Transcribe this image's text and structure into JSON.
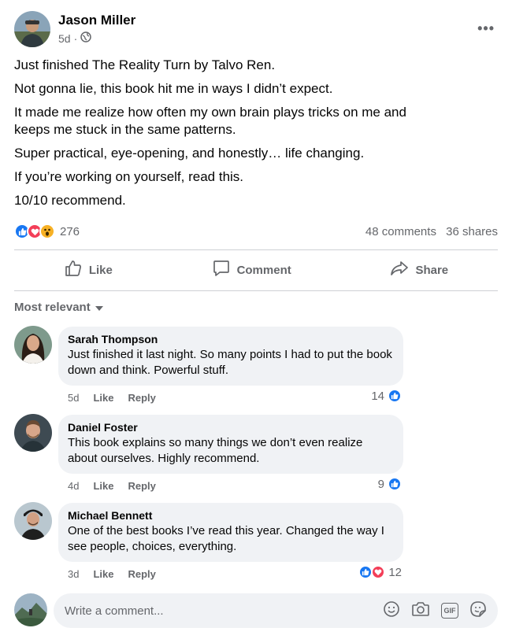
{
  "post": {
    "author": "Jason Miller",
    "time": "5d",
    "separator": "·",
    "body": [
      "Just finished The Reality Turn by Talvo Ren.",
      "Not gonna lie, this book hit me in ways I didn’t expect.",
      "It made me realize how often my own brain plays tricks on me and keeps me stuck in the same patterns.",
      "Super practical, eye-opening, and honestly… life changing.",
      "If you’re working on yourself, read this.",
      "10/10 recommend."
    ],
    "reaction_count": "276",
    "comments_count": "48 comments",
    "shares_count": "36 shares",
    "reaction_icons": [
      "like-icon",
      "love-icon",
      "wow-icon"
    ]
  },
  "actions": {
    "like": "Like",
    "comment": "Comment",
    "share": "Share"
  },
  "sort_label": "Most relevant",
  "comments": [
    {
      "name": "Sarah Thompson",
      "text": "Just finished it last night. So many points I had to put the book down and think. Powerful stuff.",
      "time": "5d",
      "like": "Like",
      "reply": "Reply",
      "reactions": "14"
    },
    {
      "name": "Daniel Foster",
      "text": "This book explains so many things we don’t even realize about ourselves. Highly recommend.",
      "time": "4d",
      "like": "Like",
      "reply": "Reply",
      "reactions": "9"
    },
    {
      "name": "Michael Bennett",
      "text": "One of the best books I’ve read this year. Changed the way I see people, choices, everything.",
      "time": "3d",
      "like": "Like",
      "reply": "Reply",
      "reactions": "12"
    }
  ],
  "composer": {
    "placeholder": "Write a comment...",
    "gif_label": "GIF"
  },
  "colors": {
    "like_blue": "#1877f2",
    "love_red": "#f33e58",
    "wow_yellow": "#f7b125",
    "muted": "#65676b",
    "bubble": "#f0f2f5"
  }
}
